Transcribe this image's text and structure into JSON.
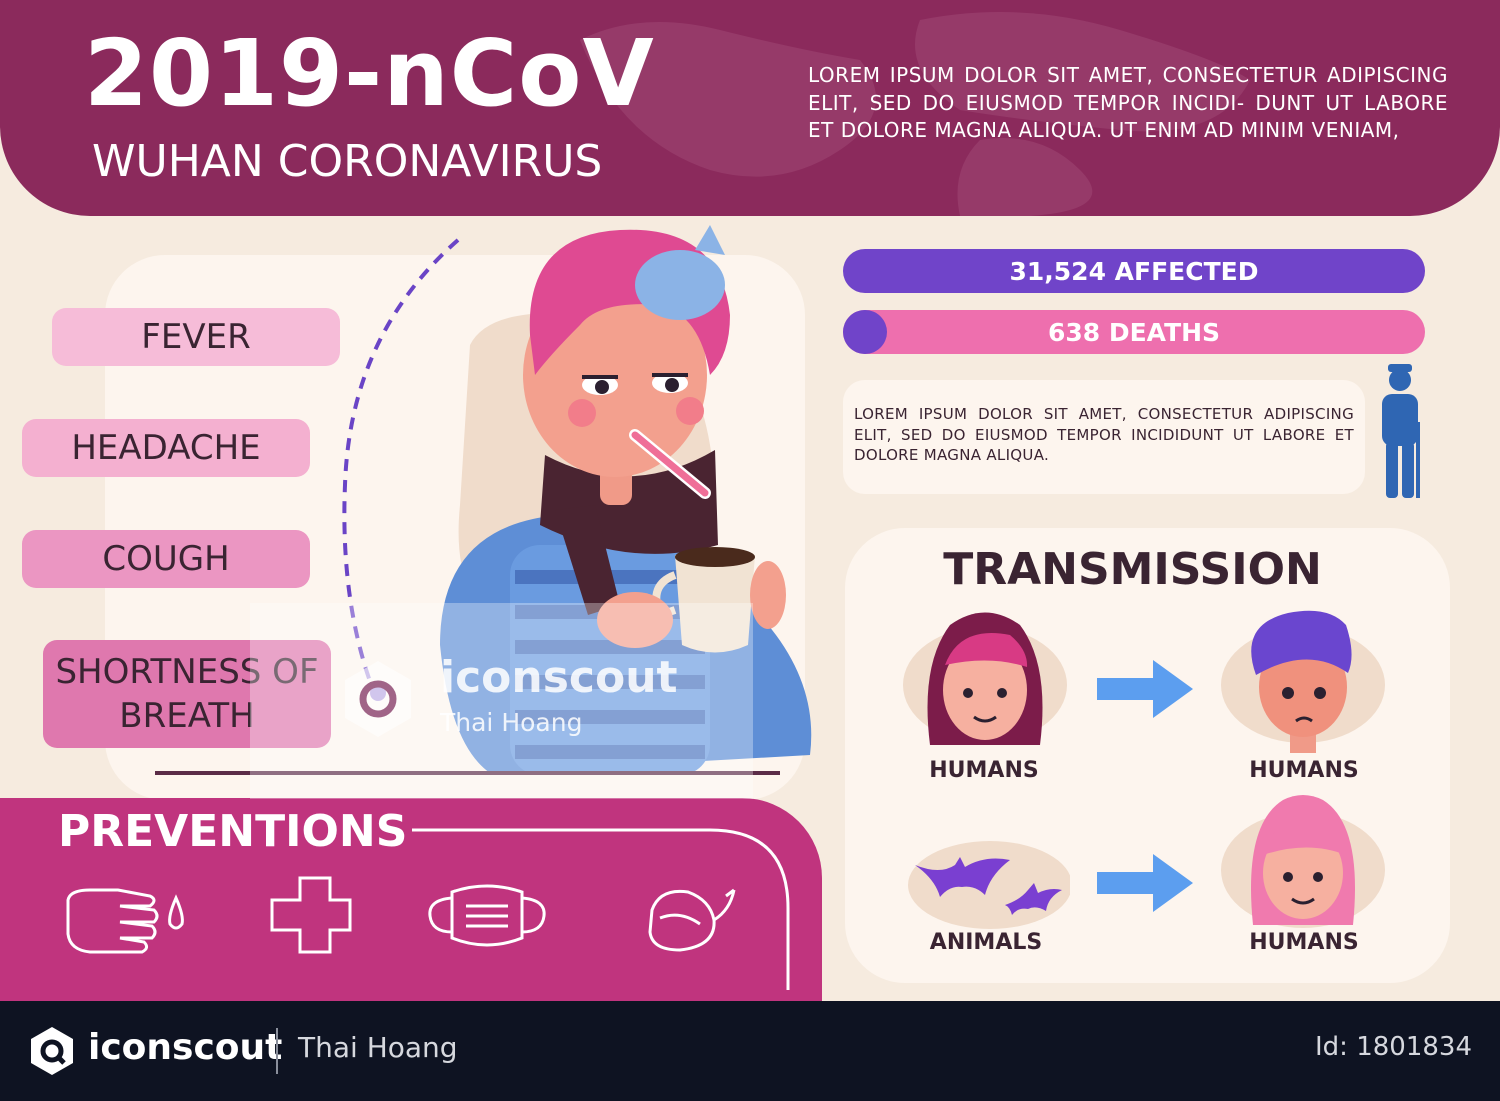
{
  "header": {
    "title": "2019-nCoV",
    "subtitle": "WUHAN CORONAVIRUS",
    "intro": "LOREM IPSUM DOLOR SIT AMET, CONSECTETUR ADIPISCING ELIT, SED DO EIUSMOD TEMPOR INCIDI- DUNT UT LABORE ET DOLORE MAGNA ALIQUA. UT ENIM AD MINIM VENIAM,"
  },
  "symptoms": {
    "items": [
      "FEVER",
      "HEADACHE",
      "COUGH",
      "SHORTNESS OF BREATH"
    ]
  },
  "stats": {
    "affected": "31,524 AFFECTED",
    "deaths": "638 DEATHS",
    "info": "LOREM IPSUM DOLOR SIT AMET, CONSECTETUR ADIPISCING ELIT, SED DO EIUSMOD TEMPOR INCIDIDUNT UT LABORE ET DOLORE MAGNA ALIQUA."
  },
  "transmission": {
    "title": "TRANSMISSION",
    "labels": [
      "HUMANS",
      "HUMANS",
      "ANIMALS",
      "HUMANS"
    ]
  },
  "preventions": {
    "title": "PREVENTIONS",
    "icons": [
      "hand-wash-icon",
      "medical-cross-icon",
      "face-mask-icon",
      "meat-icon"
    ]
  },
  "watermark": {
    "brand": "iconscout",
    "author": "Thai Hoang"
  },
  "footer": {
    "brand": "iconscout",
    "author": "Thai Hoang",
    "id": "Id: 1801834"
  },
  "colors": {
    "header": "#8b2a5c",
    "affected": "#7044c9",
    "deaths": "#ee6fae",
    "preventions": "#c0347e",
    "footer": "#0e1322"
  }
}
